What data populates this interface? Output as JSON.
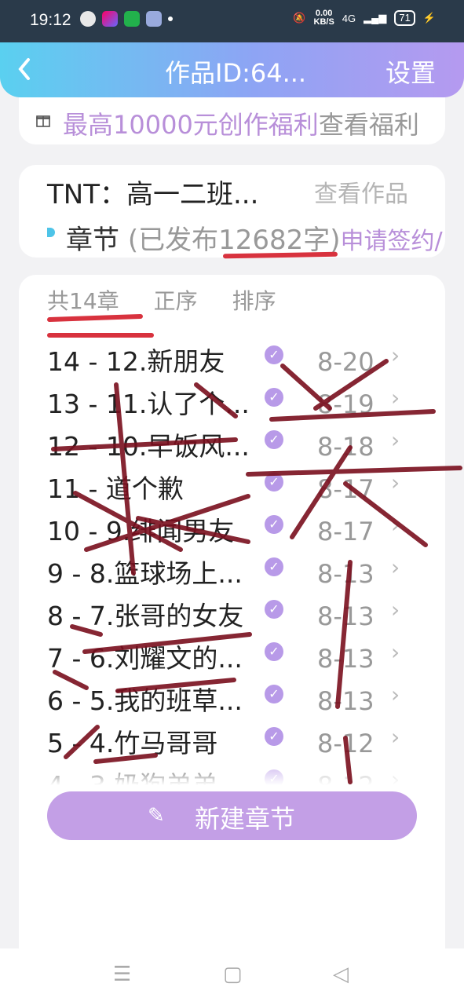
{
  "status_bar": {
    "time": "19:12",
    "net_speed_value": "0.00",
    "net_speed_unit": "KB/S",
    "network": "4G",
    "battery": "71"
  },
  "header": {
    "back_icon": "chevron-left-icon",
    "title": "作品ID:64...",
    "settings": "设置"
  },
  "promo": {
    "highlight": "最高10000元创作福利",
    "link": "查看福利"
  },
  "work": {
    "title": "TNT：高一二班...",
    "view": "查看作品",
    "chapter_label": "章节",
    "published": "(已发布12682字)",
    "sign": "申请签约/"
  },
  "tabs": {
    "count": "共14章",
    "order": "正序",
    "sort": "排序"
  },
  "chapters": [
    {
      "title": "14 - 12.新朋友",
      "date": "8-20"
    },
    {
      "title": "13 - 11.认了个...",
      "date": "8-19"
    },
    {
      "title": "12 - 10.早饭风...",
      "date": "8-18"
    },
    {
      "title": "11 - 道个歉",
      "date": "8-17"
    },
    {
      "title": "10 - 9.绯闻男友",
      "date": "8-17"
    },
    {
      "title": "9 - 8.篮球场上...",
      "date": "8-13"
    },
    {
      "title": "8 - 7.张哥的女友",
      "date": "8-13"
    },
    {
      "title": "7 - 6.刘耀文的...",
      "date": "8-13"
    },
    {
      "title": "6 - 5.我的班草...",
      "date": "8-13"
    },
    {
      "title": "5 - 4.竹马哥哥",
      "date": "8-12"
    },
    {
      "title": "4 - 3.奶狗弟弟",
      "date": "8-12"
    }
  ],
  "new_chapter": "新建章节",
  "colors": {
    "accent": "#b88fd9",
    "button": "#c39fe6",
    "header_start": "#5ad0f0",
    "header_end": "#b59af0",
    "annotation": "#7a0f1e"
  }
}
